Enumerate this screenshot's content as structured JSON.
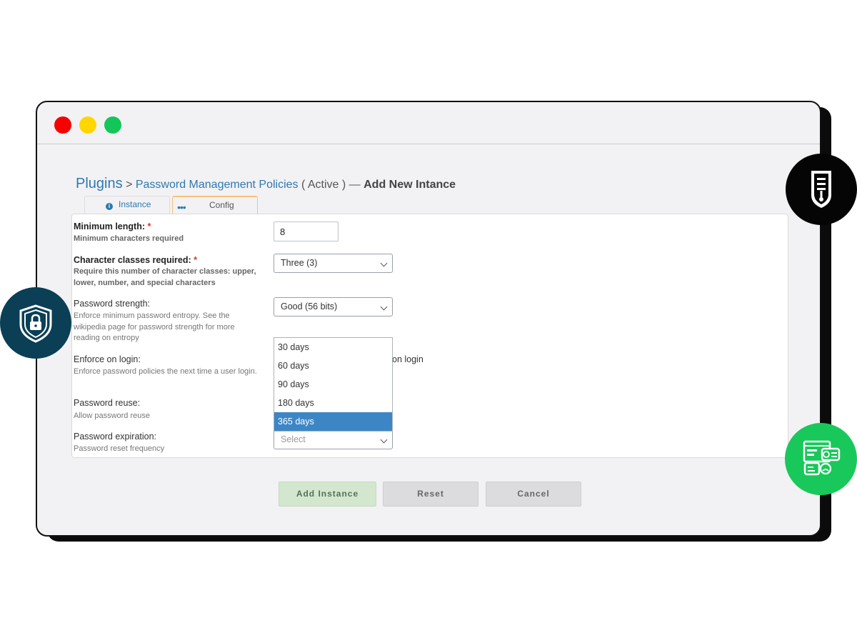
{
  "breadcrumb": {
    "root": "Plugins",
    "separator": ">",
    "plugin": "Password Management Policies",
    "status": "( Active )",
    "dash": "—",
    "current": "Add New Intance"
  },
  "tabs": [
    {
      "label": "Instance",
      "icon": "info-icon"
    },
    {
      "label": "Config",
      "icon": "more-dots-icon"
    }
  ],
  "form": {
    "min_length": {
      "label": "Minimum length:",
      "required_mark": "*",
      "help": "Minimum characters required",
      "value": "8"
    },
    "char_classes": {
      "label": "Character classes required:",
      "required_mark": "*",
      "help": "Require this number of character classes: upper, lower, number, and special characters",
      "value": "Three (3)"
    },
    "strength": {
      "label": "Password strength:",
      "help": "Enforce minimum password entropy. See the wikipedia page for password strength for more reading on entropy",
      "value": "Good (56 bits)"
    },
    "enforce_login": {
      "label": "Enforce on login:",
      "help": "Enforce password policies the next time a user login.",
      "partial_text": "on login"
    },
    "reuse": {
      "label": "Password reuse:",
      "help": "Allow password reuse"
    },
    "expiration": {
      "label": "Password expiration:",
      "help": "Password reset frequency",
      "placeholder": "Select"
    }
  },
  "expiration_options": [
    "30 days",
    "60 days",
    "90 days",
    "180 days",
    "365 days"
  ],
  "expiration_highlighted": "365 days",
  "buttons": {
    "add": "Add Instance",
    "reset": "Reset",
    "cancel": "Cancel"
  },
  "colors": {
    "accent": "#2f78b0",
    "highlight": "#3d86c6",
    "required": "#d9342b",
    "traffic_red": "#f90000",
    "traffic_yellow": "#ffd600",
    "traffic_green": "#13c659",
    "badge_dark": "#050505",
    "badge_teal": "#0a3f56",
    "badge_green": "#19c85a"
  },
  "decor_icons": [
    "policy-document-icon",
    "shield-lock-icon",
    "feedback-chat-icon"
  ]
}
